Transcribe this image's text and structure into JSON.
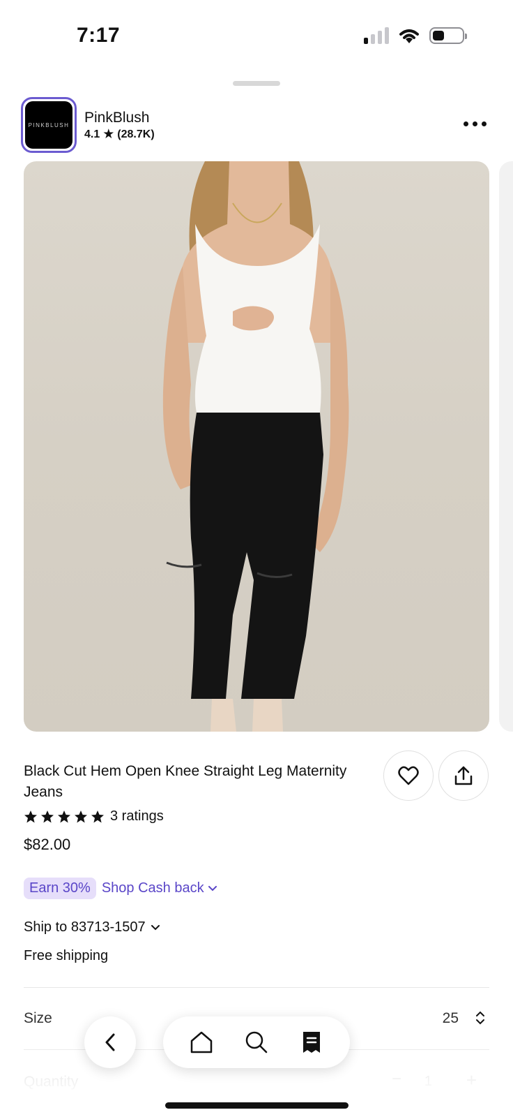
{
  "status_bar": {
    "time": "7:17",
    "signal_bars_filled": 1,
    "signal_bars_total": 4,
    "battery_level": 0.4
  },
  "shop": {
    "logo_text": "PINKBLUSH",
    "name": "PinkBlush",
    "rating": "4.1",
    "rating_count": "(28.7K)"
  },
  "product": {
    "image_alt": "Black Cut Hem Open Knee Straight Leg Maternity Jeans",
    "title": "Black Cut Hem Open Knee Straight Leg Maternity Jeans",
    "stars": 5,
    "ratings_text": "3 ratings",
    "price": "$82.00"
  },
  "cashback": {
    "badge": "Earn 30%",
    "link": "Shop Cash back"
  },
  "shipping": {
    "ship_to": "Ship to 83713-1507",
    "free_shipping": "Free shipping"
  },
  "options": {
    "size_label": "Size",
    "size_value": "25",
    "quantity_label": "Quantity",
    "quantity_value": "1",
    "minus": "−",
    "plus": "+"
  },
  "colors": {
    "accent": "#5a46c8",
    "accent_bg": "#e6defa",
    "logo_ring": "#6b5bd0"
  },
  "icons": {
    "more": "more-dots-icon",
    "favorite": "heart-icon",
    "share": "share-icon",
    "back": "chevron-left-icon",
    "home": "home-icon",
    "search": "search-icon",
    "orders": "receipt-icon"
  }
}
